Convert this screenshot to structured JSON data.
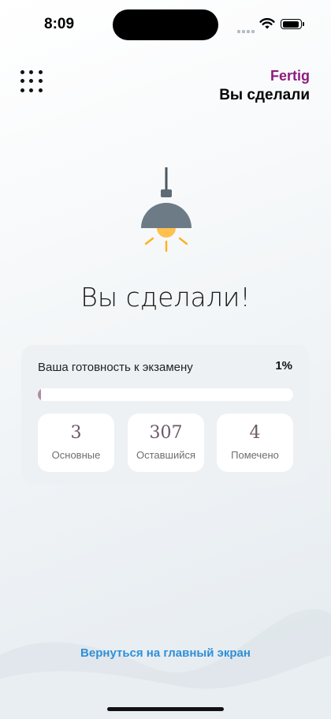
{
  "status": {
    "time": "8:09"
  },
  "header": {
    "brand": "Fertig",
    "title": "Вы сделали"
  },
  "main": {
    "done_title": "Вы сделали!"
  },
  "readiness": {
    "label": "Ваша готовность к экзамену",
    "percent_text": "1%",
    "progress": 0.01,
    "progress_color": "#b28aa0"
  },
  "stats": [
    {
      "value": "3",
      "label": "Основные"
    },
    {
      "value": "307",
      "label": "Оставшийся"
    },
    {
      "value": "4",
      "label": "Помечено"
    }
  ],
  "footer": {
    "home_link": "Вернуться на главный экран"
  },
  "colors": {
    "brand": "#8e1b7e",
    "link": "#2f8fd8",
    "stat_number": "#6b5a6a"
  },
  "icons": [
    "menu-grid-icon",
    "lamp-icon",
    "wifi-icon",
    "battery-icon",
    "signal-icon"
  ]
}
